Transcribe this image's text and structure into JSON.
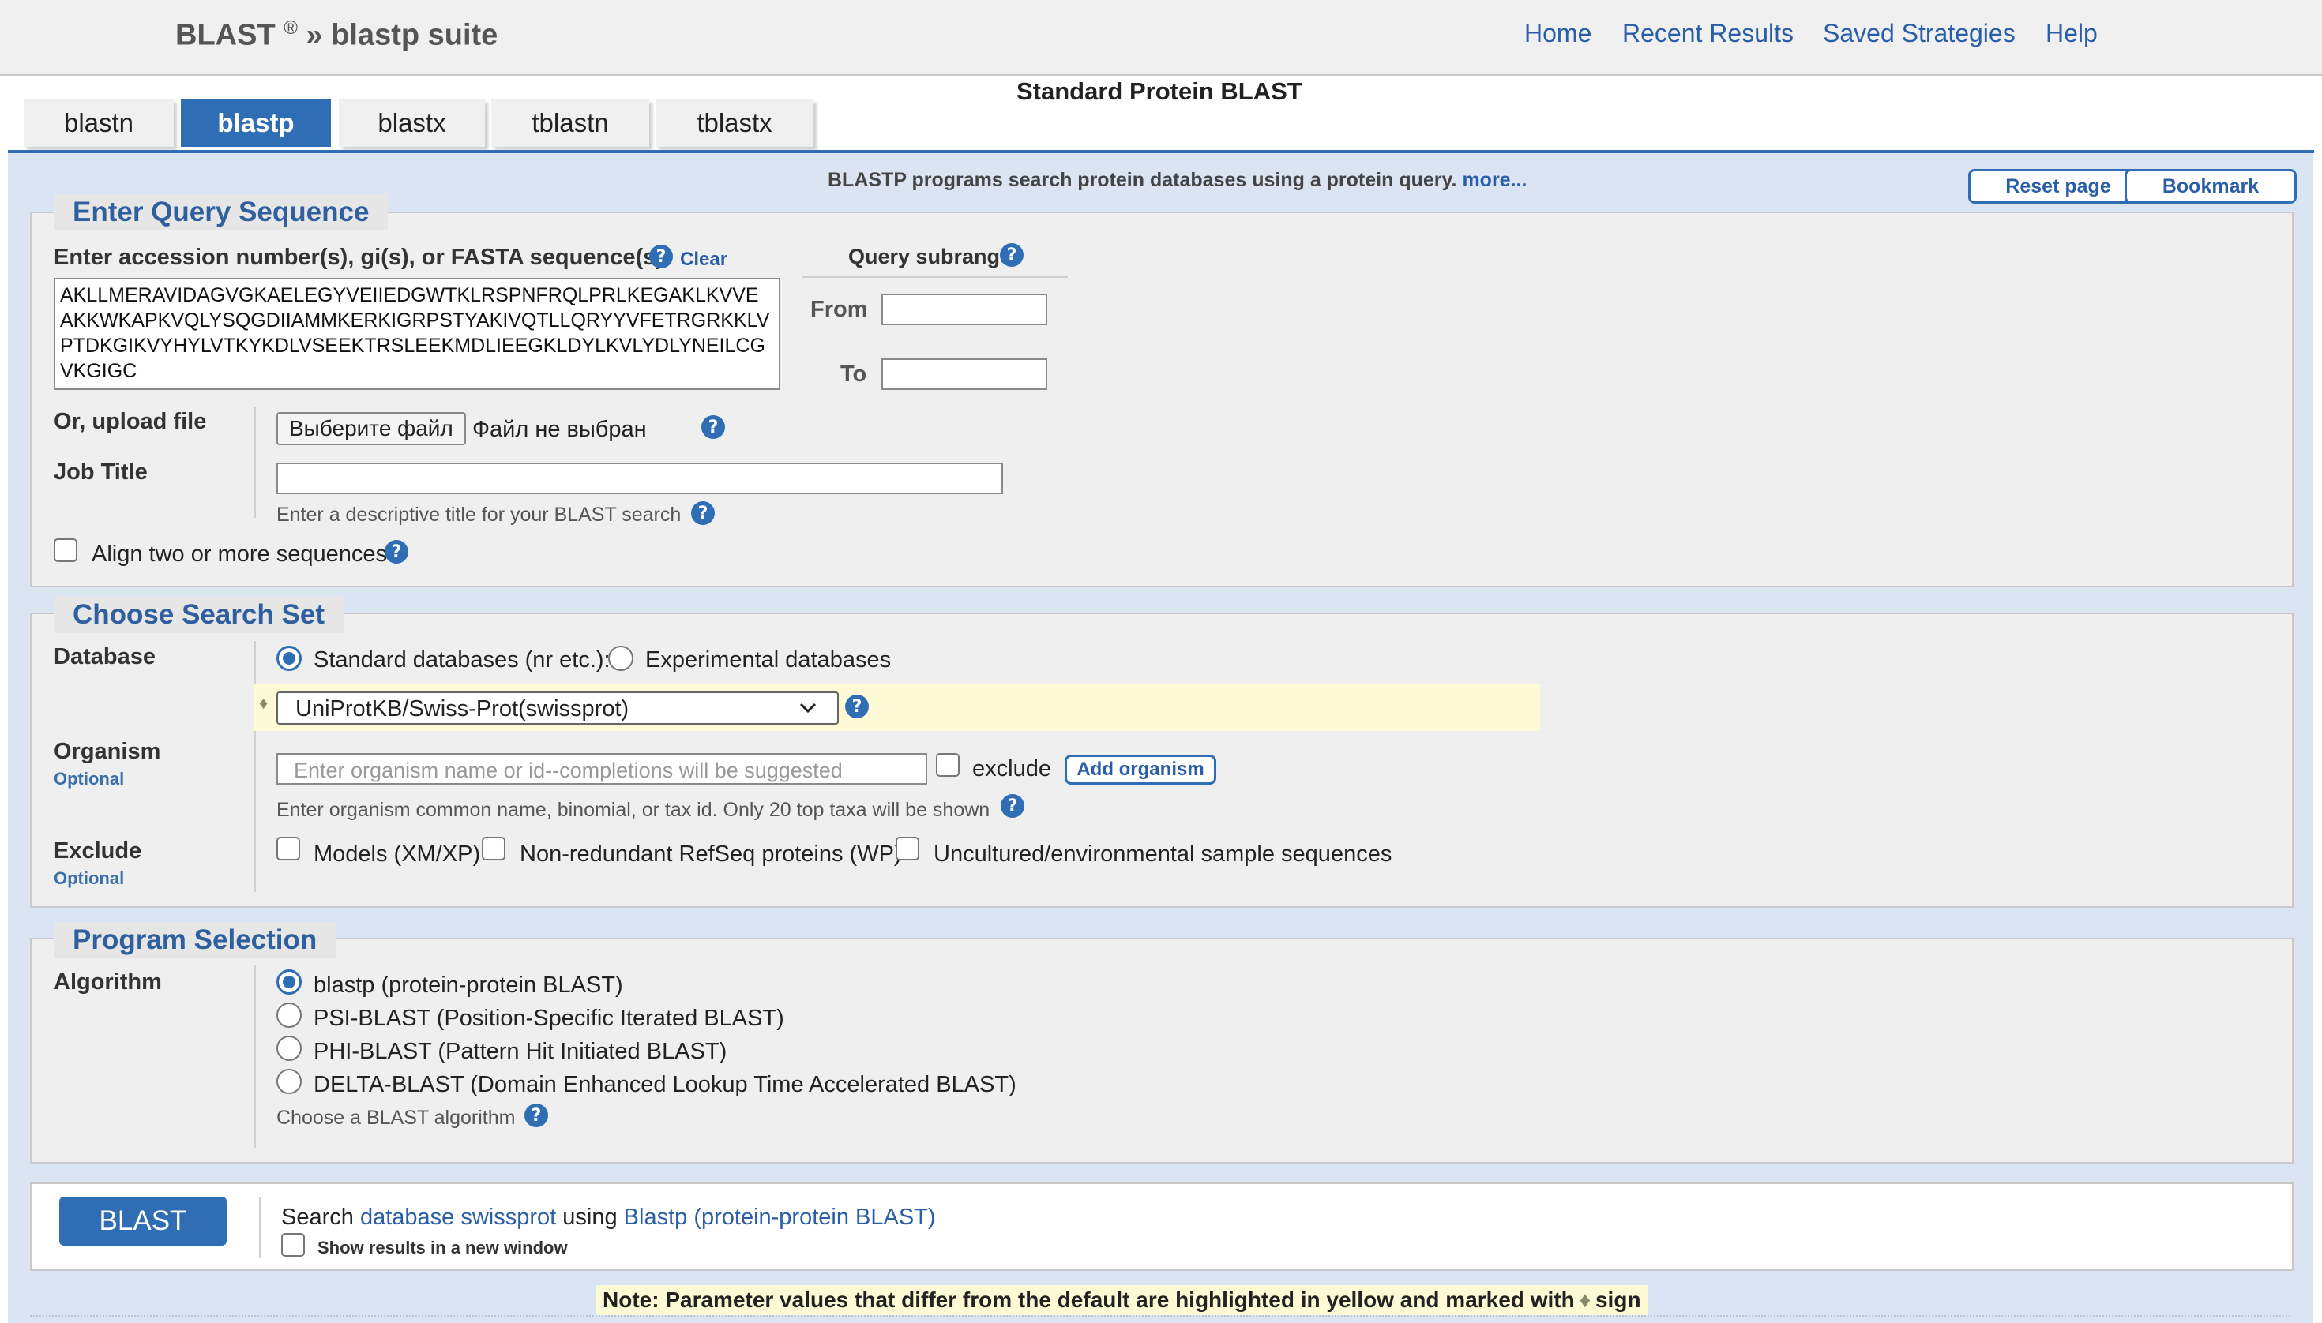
{
  "header": {
    "brand": "BLAST",
    "brand_reg": "®",
    "brand_suffix": "» blastp suite",
    "nav": [
      "Home",
      "Recent Results",
      "Saved Strategies",
      "Help"
    ],
    "page_title": "Standard Protein BLAST"
  },
  "tabs": [
    {
      "label": "blastn",
      "active": false
    },
    {
      "label": "blastp",
      "active": true
    },
    {
      "label": "blastx",
      "active": false
    },
    {
      "label": "tblastn",
      "active": false
    },
    {
      "label": "tblastx",
      "active": false
    }
  ],
  "description": {
    "text": "BLASTP programs search protein databases using a protein query.",
    "more": "more..."
  },
  "actions": {
    "reset": "Reset page",
    "bookmark": "Bookmark"
  },
  "query": {
    "legend": "Enter Query Sequence",
    "label": "Enter accession number(s), gi(s), or FASTA sequence(s)",
    "clear": "Clear",
    "sequence": "AKLLMERAVIDAGVGKAELEGYVEIIEDGWTKLRSPNFRQLPRLKEGAKLKVVE\nAKKWKAPKVQLYSQGDIIAMMKERKIGRPSTYAKIVQTLLQRYYVFETRGRKKLV\nPTDKGIKVYHYLVTKYKDLVSEEKTRSLEEKMDLIEEGKLDYLKVLYDLYNEILCG\nVKGIGC",
    "subrange_label": "Query subrange",
    "from_label": "From",
    "to_label": "To",
    "from_value": "",
    "to_value": "",
    "upload_label": "Or, upload file",
    "file_button": "Выберите файл",
    "file_status": "Файл не выбран",
    "job_title_label": "Job Title",
    "job_title_value": "",
    "job_title_hint": "Enter a descriptive title for your BLAST search",
    "align_label": "Align two or more sequences",
    "align_checked": false
  },
  "search_set": {
    "legend": "Choose Search Set",
    "database_label": "Database",
    "standard_db": "Standard databases (nr etc.):",
    "experimental_db": "Experimental databases",
    "standard_selected": true,
    "db_marker": "♦",
    "db_selected": "UniProtKB/Swiss-Prot(swissprot)",
    "organism_label": "Organism",
    "optional": "Optional",
    "organism_placeholder": "Enter organism name or id--completions will be suggested",
    "exclude_label": "exclude",
    "add_organism": "Add organism",
    "organism_hint": "Enter organism common name, binomial, or tax id. Only 20 top taxa will be shown",
    "exclude_section_label": "Exclude",
    "exclude_options": [
      "Models (XM/XP)",
      "Non-redundant RefSeq proteins (WP)",
      "Uncultured/environmental sample sequences"
    ]
  },
  "program": {
    "legend": "Program Selection",
    "algorithm_label": "Algorithm",
    "options": [
      {
        "label": "blastp (protein-protein BLAST)",
        "selected": true
      },
      {
        "label": "PSI-BLAST (Position-Specific Iterated BLAST)",
        "selected": false
      },
      {
        "label": "PHI-BLAST (Pattern Hit Initiated BLAST)",
        "selected": false
      },
      {
        "label": "DELTA-BLAST (Domain Enhanced Lookup Time Accelerated BLAST)",
        "selected": false
      }
    ],
    "hint": "Choose a BLAST algorithm"
  },
  "submit": {
    "button": "BLAST",
    "search_word": "Search",
    "database_link": "database swissprot",
    "using_word": "using",
    "program_link": "Blastp (protein-protein BLAST)",
    "new_window_label": "Show results in a new window"
  },
  "note": {
    "text_before": "Note: Parameter values that differ from the default are highlighted in yellow and marked with",
    "marker": "♦",
    "text_after": "sign"
  },
  "colors": {
    "accent": "#2f6db5",
    "panel": "#dbe4f3",
    "highlight": "#fdfad5"
  },
  "icons": {
    "help": "question-circle-icon",
    "dropdown": "chevron-down-icon",
    "diamond": "diamond-icon"
  }
}
